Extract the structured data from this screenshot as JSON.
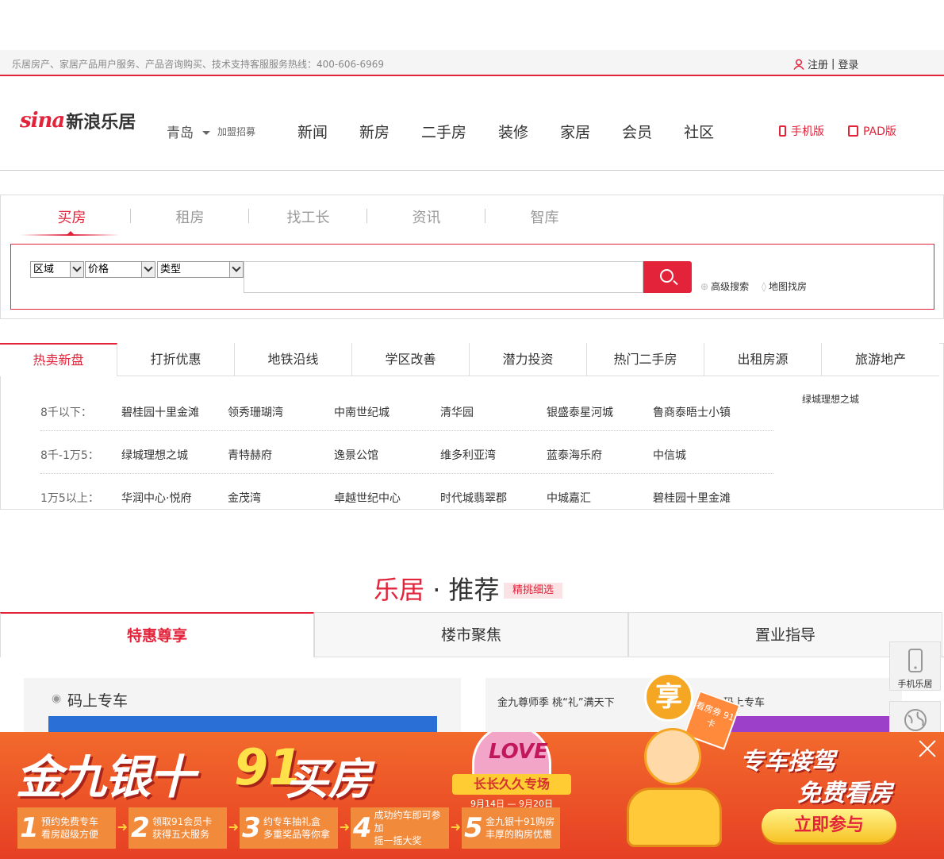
{
  "topbar": {
    "hotline": "乐居房产、家居产品用户服务、产品咨询购买、技术支持客服服务热线：400-606-6969",
    "register": "注册",
    "divider": "|",
    "login": "登录"
  },
  "header": {
    "logo_sina": "sina",
    "logo_text": "新浪乐居",
    "city": "青岛",
    "join": "加盟招募",
    "nav": [
      "新闻",
      "新房",
      "二手房",
      "装修",
      "家居",
      "会员",
      "社区"
    ],
    "mobile": "手机版",
    "pad": "PAD版"
  },
  "search": {
    "tabs": [
      "买房",
      "租房",
      "找工长",
      "资讯",
      "智库"
    ],
    "selects": [
      "区域",
      "价格",
      "类型"
    ],
    "input_value": "",
    "advanced": "高级搜索",
    "map": "地图找房"
  },
  "hot": {
    "tabs": [
      "热卖新盘",
      "打折优惠",
      "地铁沿线",
      "学区改善",
      "潜力投资",
      "热门二手房",
      "出租房源",
      "旅游地产"
    ],
    "rows": [
      {
        "label": "8千以下：",
        "items": [
          "碧桂园十里金滩",
          "领秀珊瑚湾",
          "中南世纪城",
          "清华园",
          "银盛泰星河城",
          "鲁商泰晤士小镇"
        ]
      },
      {
        "label": "8千-1万5：",
        "items": [
          "绿城理想之城",
          "青特赫府",
          "逸景公馆",
          "维多利亚湾",
          "蓝泰海乐府",
          "中信城"
        ]
      },
      {
        "label": "1万5以上：",
        "items": [
          "华润中心·悦府",
          "金茂湾",
          "卓越世纪中心",
          "时代城翡翠郡",
          "中城嘉汇",
          "碧桂园十里金滩"
        ]
      }
    ],
    "extra": "绿城理想之城"
  },
  "recommend": {
    "title_a": "乐居",
    "title_dot": " · ",
    "title_b": "推荐",
    "badge": "精挑细选",
    "tabs": [
      "特惠尊享",
      "楼市聚焦",
      "置业指导"
    ],
    "card1_title": "码上专车",
    "card2_title": "金九尊师季 桃“礼”满天下",
    "card3_title": "码上专车"
  },
  "side": {
    "mobile": "手机乐居",
    "map": "地图"
  },
  "banner": {
    "big1": "金九银十",
    "big2": "91",
    "big3": "买房",
    "steps": [
      {
        "n": "1",
        "l1": "预约免费专车",
        "l2": "看房超级方便"
      },
      {
        "n": "2",
        "l1": "领取91会员卡",
        "l2": "获得五大服务"
      },
      {
        "n": "3",
        "l1": "约专车抽礼盒",
        "l2": "多重奖品等你拿"
      },
      {
        "n": "4",
        "l1": "成功约车即可参加",
        "l2": "摇一摇大奖"
      },
      {
        "n": "5",
        "l1": "金九银十91购房",
        "l2": "丰厚的购房优惠"
      }
    ],
    "love": "LOVE",
    "love_ribbon": "长长久久专场",
    "love_date": "9月14日 — 9月20日",
    "mascot_bubble": "享",
    "ticket": "看房券 91卡",
    "right1": "专车接驾",
    "right2": "免费看房",
    "join": "立即参与"
  },
  "colors": {
    "accent": "#e2233a",
    "banner": "#e63f24",
    "gold": "#ffe14a"
  }
}
